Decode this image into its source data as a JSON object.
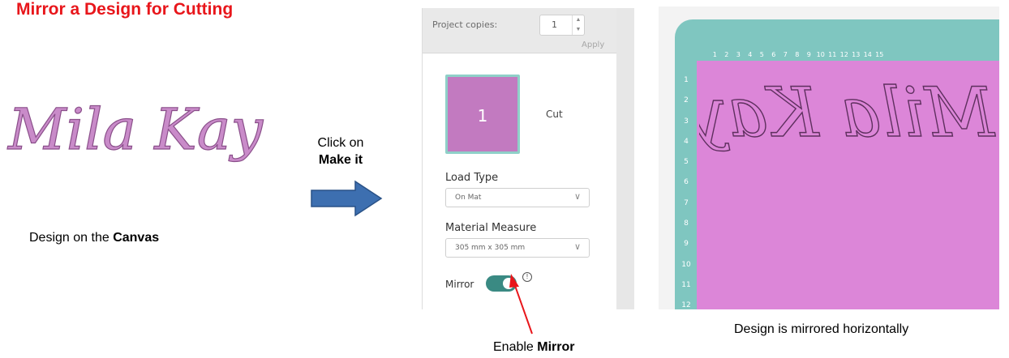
{
  "title": "Mirror a  Design for Cutting",
  "design_text": "Mila Kay",
  "canvas_caption": {
    "prefix": "Design on the ",
    "emphasis": "Canvas"
  },
  "click_caption": {
    "prefix": "Click on",
    "emphasis": "Make it"
  },
  "panel": {
    "project_copies_label": "Project copies:",
    "project_copies_value": "1",
    "apply_label": "Apply",
    "mat_number": "1",
    "mat_label": "Cut",
    "load_type_label": "Load Type",
    "load_type_value": "On Mat",
    "material_measure_label": "Material Measure",
    "material_measure_value": "305 mm x 305 mm",
    "mirror_label": "Mirror",
    "mirror_enabled": true,
    "info_glyph": "!"
  },
  "mirror_caption": {
    "prefix": "Enable ",
    "emphasis": "Mirror"
  },
  "mat_preview": {
    "ruler_top": [
      "1",
      "2",
      "3",
      "4",
      "5",
      "6",
      "7",
      "8",
      "9",
      "10",
      "11",
      "12",
      "13",
      "14",
      "15"
    ],
    "ruler_left": [
      "1",
      "2",
      "3",
      "4",
      "5",
      "6",
      "7",
      "8",
      "9",
      "10",
      "11",
      "12"
    ]
  },
  "mirrored_caption": "Design is mirrored horizontally",
  "colors": {
    "title_red": "#e8161b",
    "design_pink": "#c98bc9",
    "mat_teal": "#7fc6c0",
    "mat_pink": "#dc86d8",
    "toggle_teal": "#3a8a83",
    "arrow_blue": "#3d6fb0"
  }
}
